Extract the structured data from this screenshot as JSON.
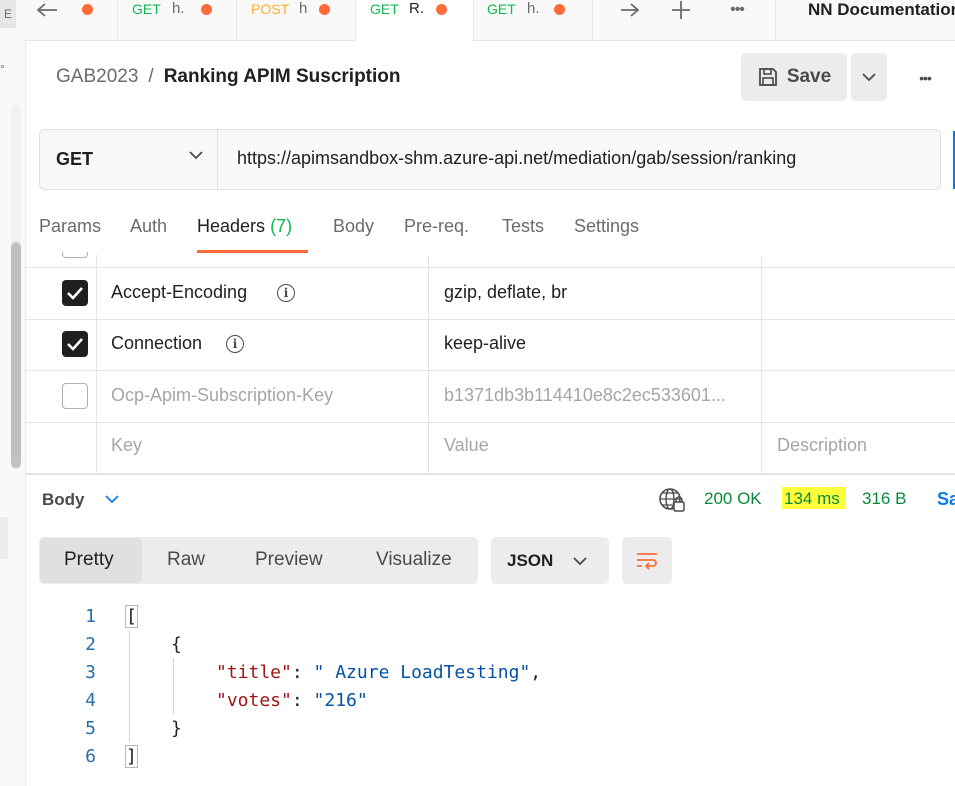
{
  "tabs": [
    {
      "method": "",
      "name": ""
    },
    {
      "method": "GET",
      "name": "h."
    },
    {
      "method": "POST",
      "name": "h"
    },
    {
      "method": "GET",
      "name": "R."
    },
    {
      "method": "GET",
      "name": "h."
    }
  ],
  "environment": {
    "name": "NN Documentation"
  },
  "left_strip": {
    "top_label": "E",
    "degree": "°"
  },
  "breadcrumb": {
    "collection": "GAB2023",
    "separator": "/",
    "request": "Ranking APIM Suscription"
  },
  "toolbar": {
    "save_label": "Save",
    "more": "•••"
  },
  "request": {
    "method": "GET",
    "url": "https://apimsandbox-shm.azure-api.net/mediation/gab/session/ranking"
  },
  "request_tabs": {
    "params": "Params",
    "auth": "Auth",
    "headers": "Headers",
    "headers_count": "(7)",
    "body": "Body",
    "prereq": "Pre-req.",
    "tests": "Tests",
    "settings": "Settings"
  },
  "headers_table": {
    "rows": [
      {
        "key": "Accept-Encoding",
        "value": "gzip, deflate, br",
        "checked": true
      },
      {
        "key": "Connection",
        "value": "keep-alive",
        "checked": true
      },
      {
        "key": "Ocp-Apim-Subscription-Key",
        "value": "b1371db3b114410e8c2ec533601...",
        "checked": false
      }
    ],
    "placeholders": {
      "key": "Key",
      "value": "Value",
      "description": "Description"
    }
  },
  "response": {
    "body_label": "Body",
    "status": "200 OK",
    "time": "134 ms",
    "size": "316 B",
    "save_partial": "Sa",
    "modes": [
      "Pretty",
      "Raw",
      "Preview",
      "Visualize"
    ],
    "format": "JSON",
    "line_numbers": [
      "1",
      "2",
      "3",
      "4",
      "5",
      "6"
    ],
    "code": {
      "l1": "[",
      "l2": "{",
      "l3_key": "\"title\"",
      "l3_colon": ": ",
      "l3_val": "\" Azure LoadTesting\"",
      "l3_comma": ",",
      "l4_key": "\"votes\"",
      "l4_colon": ": ",
      "l4_val": "\"216\"",
      "l5": "}",
      "l6": "]"
    }
  },
  "colors": {
    "accent": "#ff6c37",
    "get": "#0cbb52",
    "post": "#ffad30",
    "status_ok": "#0a8a3c",
    "highlight": "#ffff3a"
  }
}
